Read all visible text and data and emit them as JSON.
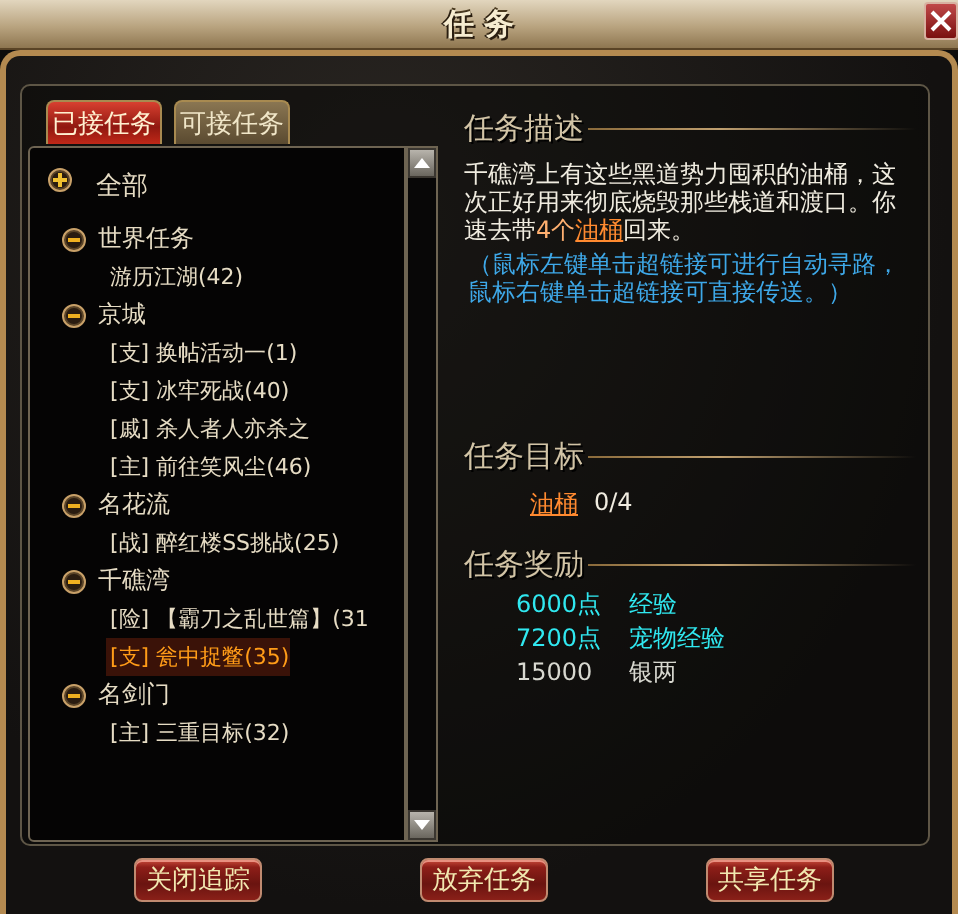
{
  "window": {
    "title": "任 务"
  },
  "tabs": [
    {
      "label": "已接任务",
      "selected": true
    },
    {
      "label": "可接任务",
      "selected": false
    }
  ],
  "tree": {
    "label": "全部",
    "kind": "root",
    "children": [
      {
        "label": "世界任务",
        "kind": "group",
        "children": [
          {
            "label": "游历江湖(42)",
            "selected": false
          }
        ]
      },
      {
        "label": "京城",
        "kind": "group",
        "children": [
          {
            "label": "[支] 换帖活动一(1)",
            "selected": false
          },
          {
            "label": "[支] 冰牢死战(40)",
            "selected": false
          },
          {
            "label": "[戚] 杀人者人亦杀之",
            "selected": false
          },
          {
            "label": "[主] 前往笑风尘(46)",
            "selected": false
          }
        ]
      },
      {
        "label": "名花流",
        "kind": "group",
        "children": [
          {
            "label": "[战] 醉红楼SS挑战(25)",
            "selected": false
          }
        ]
      },
      {
        "label": "千礁湾",
        "kind": "group",
        "children": [
          {
            "label": "[险] 【霸刀之乱世篇】(31",
            "selected": false
          },
          {
            "label": "[支] 瓮中捉鳖(35)",
            "selected": true
          }
        ]
      },
      {
        "label": "名剑门",
        "kind": "group",
        "children": [
          {
            "label": "[主] 三重目标(32)",
            "selected": false
          }
        ]
      }
    ]
  },
  "description": {
    "heading": "任务描述",
    "segments": [
      {
        "kind": "text",
        "text": "千礁湾上有这些黑道势力囤积的油桶，这次正好用来彻底烧毁那些栈道和渡口。你速去带"
      },
      {
        "kind": "count",
        "text": "4个"
      },
      {
        "kind": "link",
        "text": "油桶"
      },
      {
        "kind": "text",
        "text": "回来。"
      }
    ],
    "hint": "（鼠标左键单击超链接可进行自动寻路，鼠标右键单击超链接可直接传送。）"
  },
  "objective": {
    "heading": "任务目标",
    "target": "油桶",
    "progress": "0/4"
  },
  "rewards": {
    "heading": "任务奖励",
    "items": [
      {
        "amount": "6000点",
        "label": "经验",
        "color": "#30e8f0"
      },
      {
        "amount": "7200点",
        "label": "宠物经验",
        "color": "#30e8f0"
      },
      {
        "amount": "15000",
        "label": "银两",
        "color": "#d8d8d0"
      }
    ]
  },
  "buttons": [
    "关闭追踪",
    "放弃任务",
    "共享任务"
  ]
}
